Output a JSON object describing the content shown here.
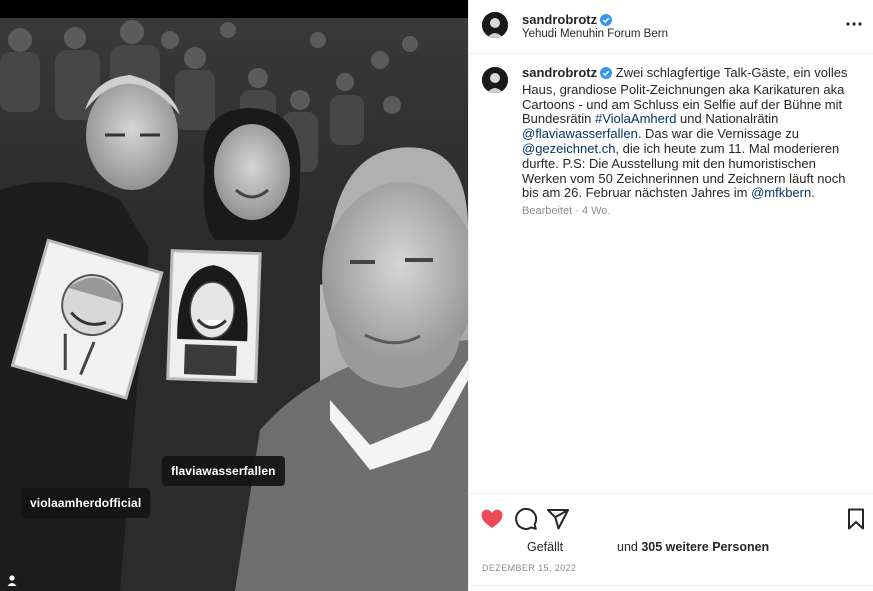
{
  "photo": {
    "tags": {
      "flavia": "flaviawasserfallen",
      "viola": "violaamherdofficial"
    }
  },
  "header": {
    "username": "sandrobrotz",
    "location": "Yehudi Menuhin Forum Bern",
    "avatar_icon": "profile-avatar",
    "more_icon": "more-horizontal-icon"
  },
  "caption": {
    "username": "sandrobrotz",
    "text_1": "Zwei schlagfertige Talk-Gäste, ein volles Haus, grandiose Polit-Zeichnungen aka Karikaturen aka Cartoons - und am Schluss ein Selfie auf der Bühne mit Bundesrätin ",
    "hashtag": "#ViolaAmherd",
    "text_2": " und Nationalrätin ",
    "mention_1": "@flaviawasserfallen",
    "text_3": ". Das war die Vernissage zu ",
    "mention_2": "@gezeichnet.ch",
    "text_4": ", die ich heute zum 11. Mal moderieren durfte. P.S: Die Ausstellung mit den humoristischen Werken vom 50 Zeichnerinnen und Zeichnern läuft noch bis am 26. Februar nächsten Jahres im ",
    "mention_3": "@mfkbern",
    "text_5": ".",
    "edited": "Bearbeitet",
    "separator": " · ",
    "age": "4 Wo."
  },
  "actions": {
    "liked_by_label": "Gefällt",
    "and_label": "und ",
    "others_label": "305 weitere Personen",
    "date": "DEZEMBER 15, 2022",
    "like_color": "#ed4956",
    "link_color": "#00376b",
    "verified_color": "#3897f0"
  }
}
